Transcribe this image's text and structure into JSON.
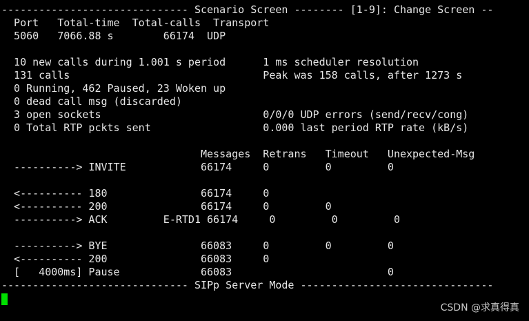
{
  "terminal": {
    "lines": [
      "------------------------------ Scenario Screen -------- [1-9]: Change Screen --",
      "  Port   Total-time  Total-calls  Transport",
      "  5060   7066.88 s        66174  UDP",
      "",
      "  10 new calls during 1.001 s period      1 ms scheduler resolution",
      "  131 calls                               Peak was 158 calls, after 1273 s",
      "  0 Running, 462 Paused, 23 Woken up",
      "  0 dead call msg (discarded)",
      "  3 open sockets                          0/0/0 UDP errors (send/recv/cong)",
      "  0 Total RTP pckts sent                  0.000 last period RTP rate (kB/s)",
      "",
      "                                Messages  Retrans   Timeout   Unexpected-Msg",
      "  ----------> INVITE            66174     0         0         0",
      "",
      "  <---------- 180               66174     0",
      "  <---------- 200               66174     0         0",
      "  ----------> ACK         E-RTD1 66174     0         0         0",
      "",
      "  ----------> BYE               66083     0         0         0",
      "  <---------- 200               66083     0",
      "  [   4000ms] Pause             66083                         0",
      "------------------------------ SIPp Server Mode -------------------------------"
    ],
    "cursor_color": "#00e000",
    "text_color": "#e6e6e6",
    "background_color": "#000000"
  },
  "watermark": {
    "text": "CSDN @求真得真"
  }
}
